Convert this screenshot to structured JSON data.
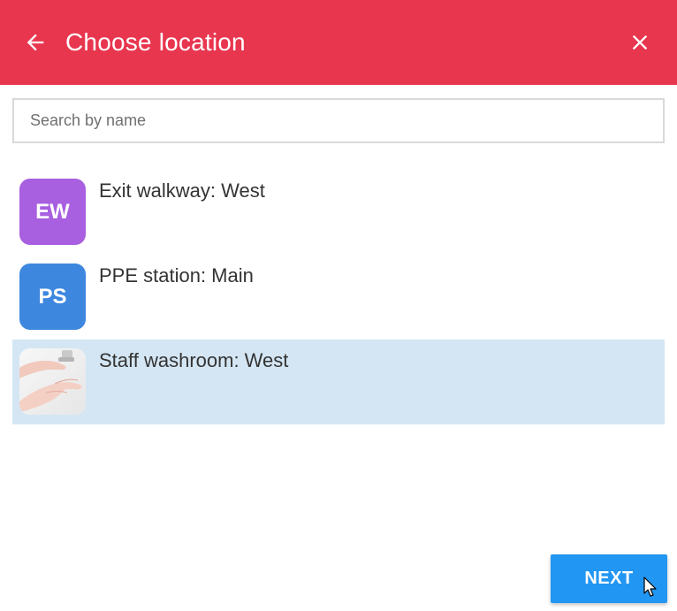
{
  "header": {
    "title": "Choose location",
    "background": "#e8364f",
    "back_icon": "arrow-left-icon",
    "close_icon": "close-icon"
  },
  "search": {
    "placeholder": "Search by name",
    "value": ""
  },
  "locations": [
    {
      "initials": "EW",
      "label": "Exit walkway: West",
      "avatar_color": "#a85fe0",
      "selected": false
    },
    {
      "initials": "PS",
      "label": "PPE station: Main",
      "avatar_color": "#3d87df",
      "selected": false
    },
    {
      "initials": "",
      "label": "Staff washroom: West",
      "avatar_image": "hand-washing-photo",
      "selected": true
    }
  ],
  "footer": {
    "next_label": "NEXT",
    "next_color": "#2196f3"
  },
  "selection_color": "#d4e6f3"
}
